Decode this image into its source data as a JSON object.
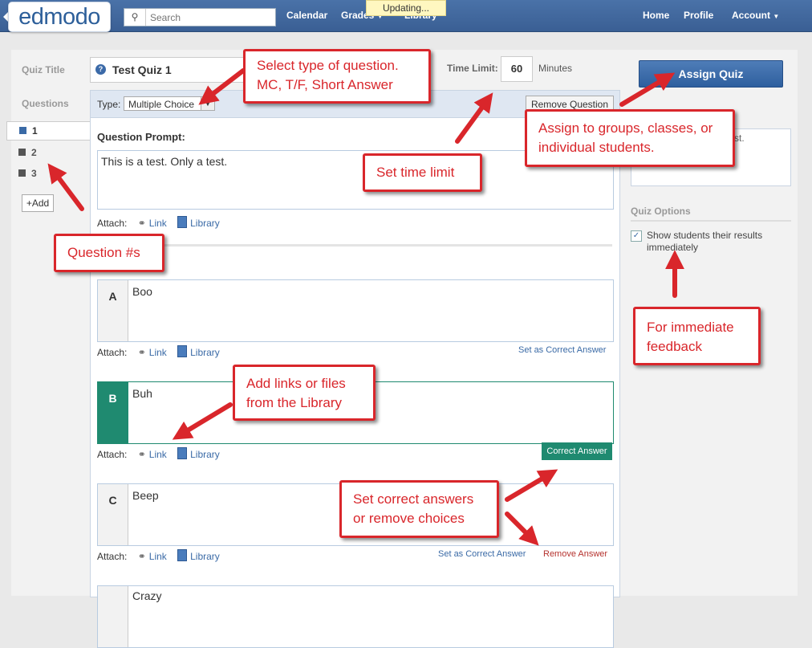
{
  "header": {
    "logo": "edmodo",
    "search_placeholder": "Search",
    "nav_left": [
      "Calendar",
      "Grades",
      "Library"
    ],
    "nav_right": [
      "Home",
      "Profile",
      "Account"
    ],
    "status": "Updating..."
  },
  "quiz": {
    "title_label": "Quiz Title",
    "title_value": "Test Quiz 1",
    "questions_label": "Questions",
    "questions": [
      "1",
      "2",
      "3"
    ],
    "add_label": "+Add",
    "time_limit_label": "Time Limit:",
    "time_limit_value": "60",
    "time_unit": "Minutes",
    "type_label": "Type:",
    "type_value": "Multiple Choice",
    "remove_question_label": "Remove Question",
    "prompt_label": "Question Prompt:",
    "prompt_value": "This is a test.  Only a test.",
    "attach_label": "Attach:",
    "link_label": "Link",
    "library_label": "Library",
    "answers": [
      {
        "letter": "A",
        "text": "Boo",
        "action": "Set as Correct Answer"
      },
      {
        "letter": "B",
        "text": "Buh",
        "action": "Correct Answer"
      },
      {
        "letter": "C",
        "text": "Beep",
        "action": "Set as Correct Answer",
        "remove": "Remove Answer"
      },
      {
        "letter": "",
        "text": "Crazy"
      }
    ]
  },
  "right": {
    "assign_label": "Assign Quiz",
    "assign_box_text": "st.",
    "quiz_options_label": "Quiz Options",
    "show_results_label": "Show students their results immediately",
    "show_results_checked": true
  },
  "callouts": {
    "type": "Select type of question.\nMC, T/F, Short Answer",
    "assign": "Assign to groups, classes, or\nindividual students.",
    "time": "Set time limit",
    "qnums": "Question #s",
    "feedback": "For immediate\nfeedback",
    "links": "Add links or files\nfrom the Library",
    "correct": "Set correct answers\nor remove choices"
  },
  "colors": {
    "header": "#3a5f94",
    "accent_blue": "#3a6aa6",
    "correct_green": "#1f8a70",
    "callout_red": "#d9262b"
  }
}
